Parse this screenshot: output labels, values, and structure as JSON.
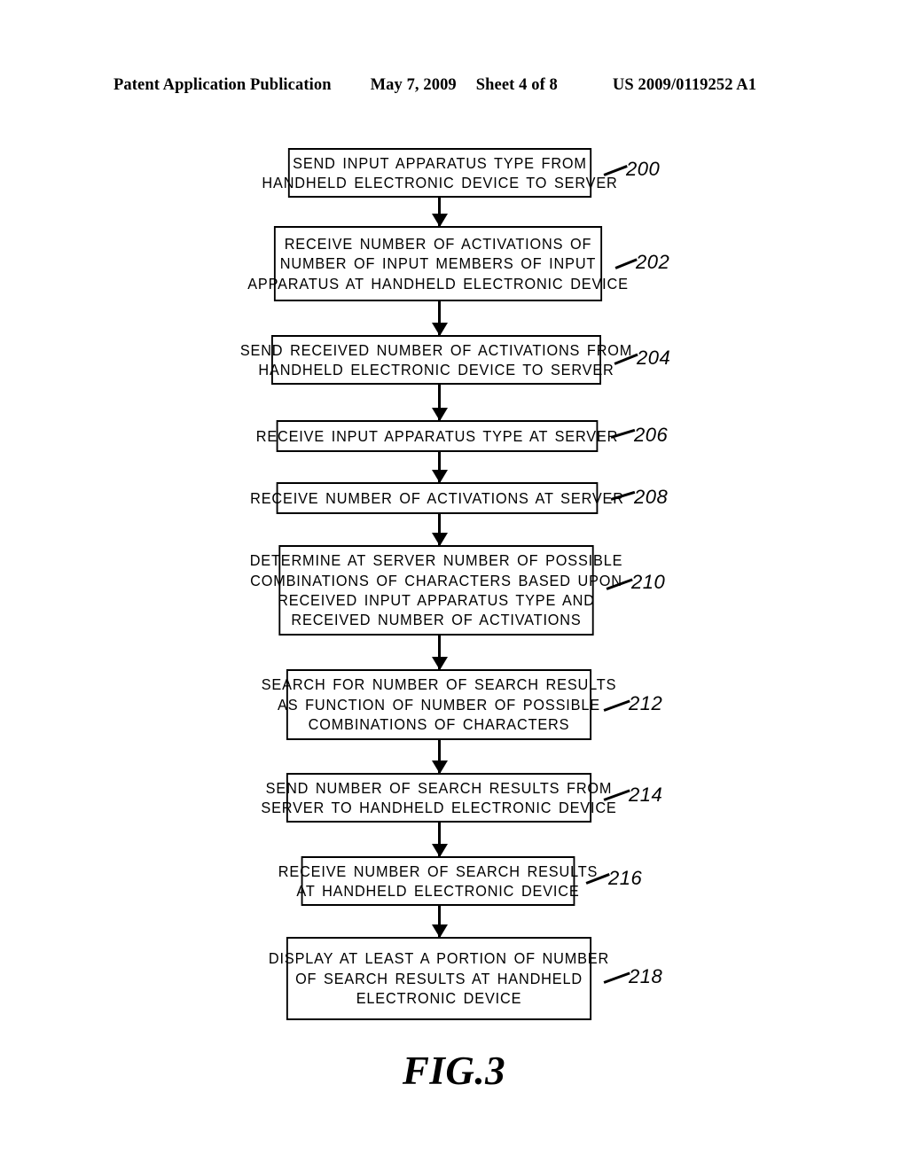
{
  "header": {
    "publication": "Patent Application Publication",
    "date": "May 7, 2009",
    "sheet": "Sheet 4 of 8",
    "document_number": "US 2009/0119252 A1"
  },
  "figure": {
    "caption": "FIG.3",
    "steps": [
      {
        "ref": "200",
        "lines": [
          "SEND INPUT APPARATUS TYPE FROM",
          "HANDHELD ELECTRONIC DEVICE TO SERVER"
        ]
      },
      {
        "ref": "202",
        "lines": [
          "RECEIVE NUMBER OF ACTIVATIONS OF",
          "NUMBER OF INPUT MEMBERS OF INPUT",
          "APPARATUS AT HANDHELD ELECTRONIC DEVICE"
        ]
      },
      {
        "ref": "204",
        "lines": [
          "SEND RECEIVED NUMBER OF ACTIVATIONS FROM",
          "HANDHELD ELECTRONIC DEVICE TO SERVER"
        ]
      },
      {
        "ref": "206",
        "lines": [
          "RECEIVE INPUT APPARATUS TYPE AT SERVER"
        ]
      },
      {
        "ref": "208",
        "lines": [
          "RECEIVE NUMBER OF ACTIVATIONS AT SERVER"
        ]
      },
      {
        "ref": "210",
        "lines": [
          "DETERMINE AT SERVER NUMBER OF POSSIBLE",
          "COMBINATIONS OF CHARACTERS BASED UPON",
          "RECEIVED INPUT APPARATUS TYPE AND",
          "RECEIVED NUMBER OF ACTIVATIONS"
        ]
      },
      {
        "ref": "212",
        "lines": [
          "SEARCH FOR NUMBER OF SEARCH RESULTS",
          "AS FUNCTION OF NUMBER OF POSSIBLE",
          "COMBINATIONS OF CHARACTERS"
        ]
      },
      {
        "ref": "214",
        "lines": [
          "SEND NUMBER OF SEARCH RESULTS FROM",
          "SERVER TO HANDHELD ELECTRONIC DEVICE"
        ]
      },
      {
        "ref": "216",
        "lines": [
          "RECEIVE NUMBER OF SEARCH RESULTS",
          "AT HANDHELD ELECTRONIC DEVICE"
        ]
      },
      {
        "ref": "218",
        "lines": [
          "DISPLAY AT LEAST A PORTION OF NUMBER",
          "OF SEARCH RESULTS AT HANDHELD",
          "ELECTRONIC DEVICE"
        ]
      }
    ]
  },
  "colors": {
    "ink": "#000000",
    "paper": "#ffffff"
  }
}
